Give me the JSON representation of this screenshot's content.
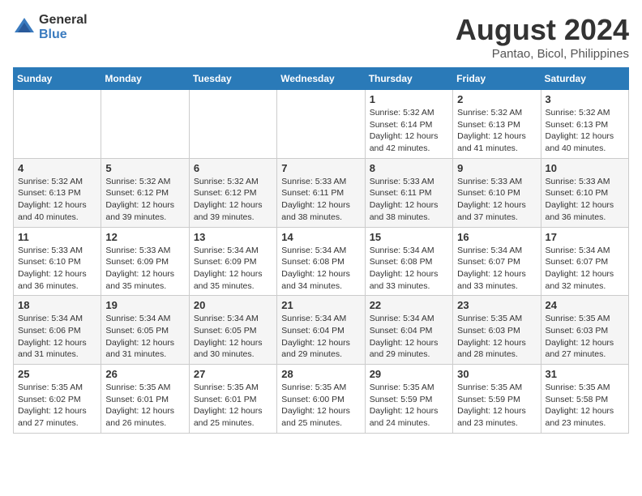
{
  "logo": {
    "general": "General",
    "blue": "Blue"
  },
  "title": "August 2024",
  "subtitle": "Pantao, Bicol, Philippines",
  "days_of_week": [
    "Sunday",
    "Monday",
    "Tuesday",
    "Wednesday",
    "Thursday",
    "Friday",
    "Saturday"
  ],
  "weeks": [
    [
      {
        "day": "",
        "info": ""
      },
      {
        "day": "",
        "info": ""
      },
      {
        "day": "",
        "info": ""
      },
      {
        "day": "",
        "info": ""
      },
      {
        "day": "1",
        "info": "Sunrise: 5:32 AM\nSunset: 6:14 PM\nDaylight: 12 hours\nand 42 minutes."
      },
      {
        "day": "2",
        "info": "Sunrise: 5:32 AM\nSunset: 6:13 PM\nDaylight: 12 hours\nand 41 minutes."
      },
      {
        "day": "3",
        "info": "Sunrise: 5:32 AM\nSunset: 6:13 PM\nDaylight: 12 hours\nand 40 minutes."
      }
    ],
    [
      {
        "day": "4",
        "info": "Sunrise: 5:32 AM\nSunset: 6:13 PM\nDaylight: 12 hours\nand 40 minutes."
      },
      {
        "day": "5",
        "info": "Sunrise: 5:32 AM\nSunset: 6:12 PM\nDaylight: 12 hours\nand 39 minutes."
      },
      {
        "day": "6",
        "info": "Sunrise: 5:32 AM\nSunset: 6:12 PM\nDaylight: 12 hours\nand 39 minutes."
      },
      {
        "day": "7",
        "info": "Sunrise: 5:33 AM\nSunset: 6:11 PM\nDaylight: 12 hours\nand 38 minutes."
      },
      {
        "day": "8",
        "info": "Sunrise: 5:33 AM\nSunset: 6:11 PM\nDaylight: 12 hours\nand 38 minutes."
      },
      {
        "day": "9",
        "info": "Sunrise: 5:33 AM\nSunset: 6:10 PM\nDaylight: 12 hours\nand 37 minutes."
      },
      {
        "day": "10",
        "info": "Sunrise: 5:33 AM\nSunset: 6:10 PM\nDaylight: 12 hours\nand 36 minutes."
      }
    ],
    [
      {
        "day": "11",
        "info": "Sunrise: 5:33 AM\nSunset: 6:10 PM\nDaylight: 12 hours\nand 36 minutes."
      },
      {
        "day": "12",
        "info": "Sunrise: 5:33 AM\nSunset: 6:09 PM\nDaylight: 12 hours\nand 35 minutes."
      },
      {
        "day": "13",
        "info": "Sunrise: 5:34 AM\nSunset: 6:09 PM\nDaylight: 12 hours\nand 35 minutes."
      },
      {
        "day": "14",
        "info": "Sunrise: 5:34 AM\nSunset: 6:08 PM\nDaylight: 12 hours\nand 34 minutes."
      },
      {
        "day": "15",
        "info": "Sunrise: 5:34 AM\nSunset: 6:08 PM\nDaylight: 12 hours\nand 33 minutes."
      },
      {
        "day": "16",
        "info": "Sunrise: 5:34 AM\nSunset: 6:07 PM\nDaylight: 12 hours\nand 33 minutes."
      },
      {
        "day": "17",
        "info": "Sunrise: 5:34 AM\nSunset: 6:07 PM\nDaylight: 12 hours\nand 32 minutes."
      }
    ],
    [
      {
        "day": "18",
        "info": "Sunrise: 5:34 AM\nSunset: 6:06 PM\nDaylight: 12 hours\nand 31 minutes."
      },
      {
        "day": "19",
        "info": "Sunrise: 5:34 AM\nSunset: 6:05 PM\nDaylight: 12 hours\nand 31 minutes."
      },
      {
        "day": "20",
        "info": "Sunrise: 5:34 AM\nSunset: 6:05 PM\nDaylight: 12 hours\nand 30 minutes."
      },
      {
        "day": "21",
        "info": "Sunrise: 5:34 AM\nSunset: 6:04 PM\nDaylight: 12 hours\nand 29 minutes."
      },
      {
        "day": "22",
        "info": "Sunrise: 5:34 AM\nSunset: 6:04 PM\nDaylight: 12 hours\nand 29 minutes."
      },
      {
        "day": "23",
        "info": "Sunrise: 5:35 AM\nSunset: 6:03 PM\nDaylight: 12 hours\nand 28 minutes."
      },
      {
        "day": "24",
        "info": "Sunrise: 5:35 AM\nSunset: 6:03 PM\nDaylight: 12 hours\nand 27 minutes."
      }
    ],
    [
      {
        "day": "25",
        "info": "Sunrise: 5:35 AM\nSunset: 6:02 PM\nDaylight: 12 hours\nand 27 minutes."
      },
      {
        "day": "26",
        "info": "Sunrise: 5:35 AM\nSunset: 6:01 PM\nDaylight: 12 hours\nand 26 minutes."
      },
      {
        "day": "27",
        "info": "Sunrise: 5:35 AM\nSunset: 6:01 PM\nDaylight: 12 hours\nand 25 minutes."
      },
      {
        "day": "28",
        "info": "Sunrise: 5:35 AM\nSunset: 6:00 PM\nDaylight: 12 hours\nand 25 minutes."
      },
      {
        "day": "29",
        "info": "Sunrise: 5:35 AM\nSunset: 5:59 PM\nDaylight: 12 hours\nand 24 minutes."
      },
      {
        "day": "30",
        "info": "Sunrise: 5:35 AM\nSunset: 5:59 PM\nDaylight: 12 hours\nand 23 minutes."
      },
      {
        "day": "31",
        "info": "Sunrise: 5:35 AM\nSunset: 5:58 PM\nDaylight: 12 hours\nand 23 minutes."
      }
    ]
  ]
}
